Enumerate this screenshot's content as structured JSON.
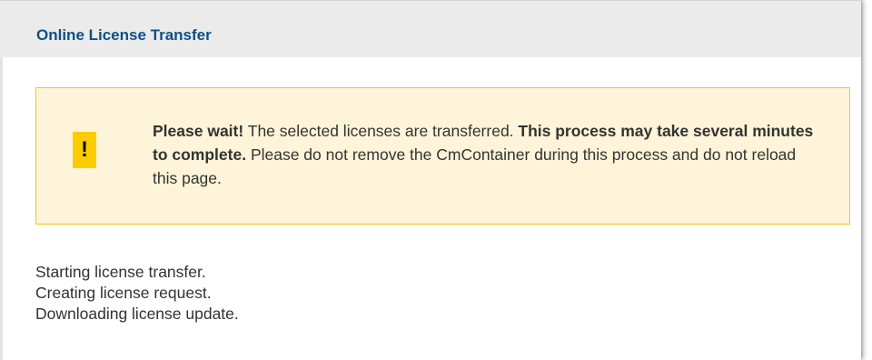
{
  "header": {
    "title": "Online License Transfer"
  },
  "warning": {
    "icon_glyph": "!",
    "icon_name": "exclamation-icon",
    "accent_color": "#fccc00",
    "background_color": "#fdf4d9",
    "border_color": "#f5c21f",
    "lead_bold": "Please wait!",
    "text_1": " The selected licenses are transferred. ",
    "emphasis_bold": "This process may take several minutes to complete.",
    "text_2": " Please do not remove the CmContainer during this process and do not reload this page."
  },
  "log": {
    "lines": [
      "Starting license transfer.",
      "Creating license request.",
      "Downloading license update."
    ]
  },
  "colors": {
    "title": "#0f4f86",
    "header_bg": "#ebebeb",
    "text": "#333333"
  }
}
